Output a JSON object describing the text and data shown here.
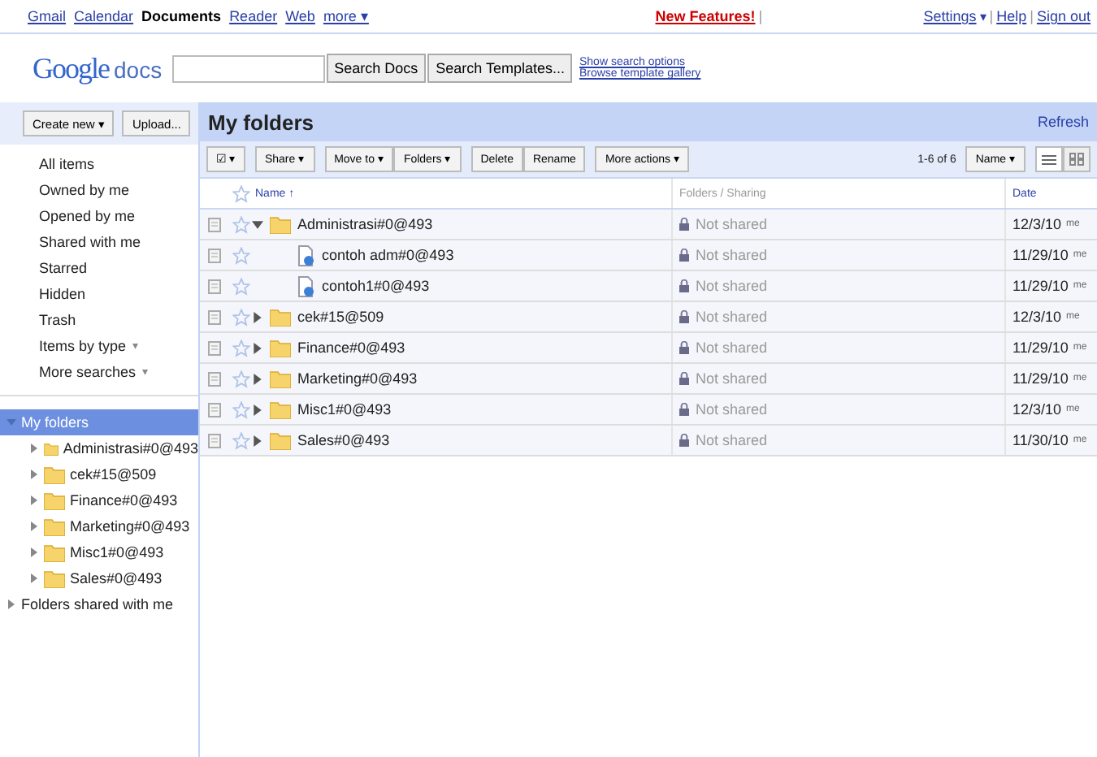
{
  "top_nav": {
    "links": [
      {
        "label": "Gmail",
        "selected": false
      },
      {
        "label": "Calendar",
        "selected": false
      },
      {
        "label": "Documents",
        "selected": true
      },
      {
        "label": "Reader",
        "selected": false
      },
      {
        "label": "Web",
        "selected": false
      }
    ],
    "more": "more ▾",
    "new_features": "New Features!",
    "separators": [
      "|",
      "|",
      "|"
    ],
    "settings": "Settings",
    "settings_caret": "▾",
    "help": "Help",
    "sign_out": "Sign out"
  },
  "header": {
    "logo_google": "Google",
    "logo_docs": "docs",
    "search_buttons": [
      "Search Docs",
      "Search Templates..."
    ],
    "links": [
      "Show search options",
      "Browse template gallery"
    ]
  },
  "sidebar": {
    "buttons": [
      "Create new ▾",
      "Upload..."
    ],
    "items": [
      {
        "label": "All items"
      },
      {
        "label": "Owned by me"
      },
      {
        "label": "Opened by me"
      },
      {
        "label": "Shared with me"
      },
      {
        "label": "Starred"
      },
      {
        "label": "Hidden"
      },
      {
        "label": "Trash"
      },
      {
        "label": "Items by type",
        "caret": "▾"
      },
      {
        "label": "More searches",
        "caret": "▾"
      }
    ],
    "tree": [
      {
        "label": "My folders",
        "expanded": true,
        "selected": true,
        "children": [
          {
            "label": "Administrasi#0@493",
            "expanded": false,
            "selected": false,
            "kind": "folder"
          },
          {
            "label": "cek#15@509",
            "expanded": false,
            "selected": false,
            "kind": "folder"
          },
          {
            "label": "Finance#0@493",
            "expanded": false,
            "selected": false,
            "kind": "folder"
          },
          {
            "label": "Marketing#0@493",
            "expanded": false,
            "selected": false,
            "kind": "folder"
          },
          {
            "label": "Misc1#0@493",
            "expanded": false,
            "selected": false,
            "kind": "folder"
          },
          {
            "label": "Sales#0@493",
            "expanded": false,
            "selected": false,
            "kind": "folder"
          }
        ]
      },
      {
        "label": "Folders shared with me",
        "expanded": false,
        "selected": false
      }
    ]
  },
  "main": {
    "title": "My folders",
    "refresh": "Refresh",
    "toolbar": [
      [
        "☑ ▾"
      ],
      [
        "Share ▾"
      ],
      [
        "Move to ▾",
        "Folders ▾"
      ],
      [
        "Delete",
        "Rename"
      ],
      [
        "More actions ▾"
      ]
    ],
    "count": "1-6 of 6",
    "sort": "Name ▾",
    "views": [
      {
        "kind": "list",
        "selected": true
      },
      {
        "kind": "grid",
        "selected": false
      }
    ],
    "table": {
      "columns": [
        "Name ↑",
        "Folders / Sharing",
        "Date"
      ],
      "rows": [
        {
          "kind": "folder",
          "checked": false,
          "name": "Administrasi#0@493",
          "sharing": "Not shared",
          "date": "12/3/10",
          "by": "me",
          "expanded": true,
          "children": [
            {
              "kind": "doc",
              "checked": false,
              "name": "contoh adm#0@493",
              "sharing": "Not shared",
              "date": "11/29/10",
              "by": "me"
            },
            {
              "kind": "doc",
              "checked": false,
              "name": "contoh1#0@493",
              "sharing": "Not shared",
              "date": "11/29/10",
              "by": "me"
            }
          ]
        },
        {
          "kind": "folder",
          "checked": false,
          "name": "cek#15@509",
          "sharing": "Not shared",
          "date": "12/3/10",
          "by": "me",
          "expanded": false
        },
        {
          "kind": "folder",
          "checked": false,
          "name": "Finance#0@493",
          "sharing": "Not shared",
          "date": "11/29/10",
          "by": "me",
          "expanded": false
        },
        {
          "kind": "folder",
          "checked": false,
          "name": "Marketing#0@493",
          "sharing": "Not shared",
          "date": "11/29/10",
          "by": "me",
          "expanded": false
        },
        {
          "kind": "folder",
          "checked": false,
          "name": "Misc1#0@493",
          "sharing": "Not shared",
          "date": "12/3/10",
          "by": "me",
          "expanded": false
        },
        {
          "kind": "folder",
          "checked": false,
          "name": "Sales#0@493",
          "sharing": "Not shared",
          "date": "11/30/10",
          "by": "me",
          "expanded": false
        }
      ]
    }
  }
}
